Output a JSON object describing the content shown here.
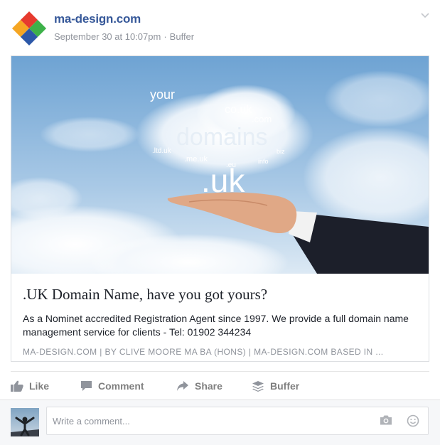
{
  "post": {
    "page_name": "ma-design.com",
    "timestamp": "September 30 at 10:07pm",
    "separator": "·",
    "source": "Buffer"
  },
  "link_card": {
    "image_words": {
      "your": "your",
      "couk": "co.uk",
      "com": ".com",
      "domains": "domains",
      "ltduk": ".ltd.uk",
      "meuk": ".me.uk",
      "eu": ".eu",
      "biz": "biz",
      "info": "info",
      "uk": ".uk"
    },
    "title": ".UK Domain Name, have you got yours?",
    "description": "As a Nominet accredited Registration Agent since 1997. We provide a full domain name management service for clients - Tel: 01902 344234",
    "domain_line": "MA-DESIGN.COM | BY CLIVE MOORE MA BA (HONS) | MA-DESIGN.COM BASED IN ..."
  },
  "actions": {
    "like": "Like",
    "comment": "Comment",
    "share": "Share",
    "buffer": "Buffer"
  },
  "comment_box": {
    "placeholder": "Write a comment..."
  },
  "colors": {
    "link_blue": "#365899",
    "meta_gray": "#90949c",
    "action_gray": "#7f7f7f",
    "sky": "#8fb8dc"
  },
  "icons": [
    "chevron-down-icon",
    "like-icon",
    "comment-icon",
    "share-icon",
    "buffer-icon",
    "camera-icon",
    "smiley-icon"
  ]
}
